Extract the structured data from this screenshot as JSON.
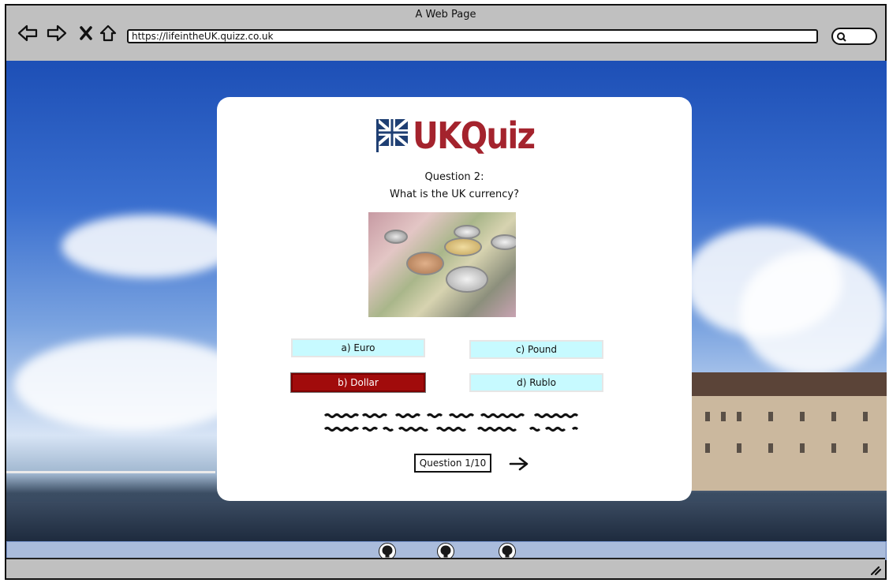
{
  "window": {
    "title": "A Web Page",
    "url": "https://lifeintheUK.quizz.co.uk"
  },
  "icons": {
    "back": "arrow-left-icon",
    "forward": "arrow-right-icon",
    "stop": "close-icon",
    "home": "home-icon",
    "search": "search-icon",
    "next": "arrow-right-icon",
    "social": "github-icon",
    "resize": "resize-grip-icon",
    "flag": "union-jack-flag-icon"
  },
  "colors": {
    "brand": "#a4232d",
    "answer_bg": "#c7faff",
    "answer_selected_bg": "#a10b0b"
  },
  "quiz": {
    "logo_text": "UKQuiz",
    "question_number": "Question 2:",
    "question_text": "What is the UK currency?",
    "answers": [
      {
        "label": "a) Euro",
        "selected": false
      },
      {
        "label": "b) Dollar",
        "selected": true
      },
      {
        "label": "c) Pound",
        "selected": false
      },
      {
        "label": "d) Rublo",
        "selected": false
      }
    ],
    "progress_label": "Question 1/10"
  }
}
